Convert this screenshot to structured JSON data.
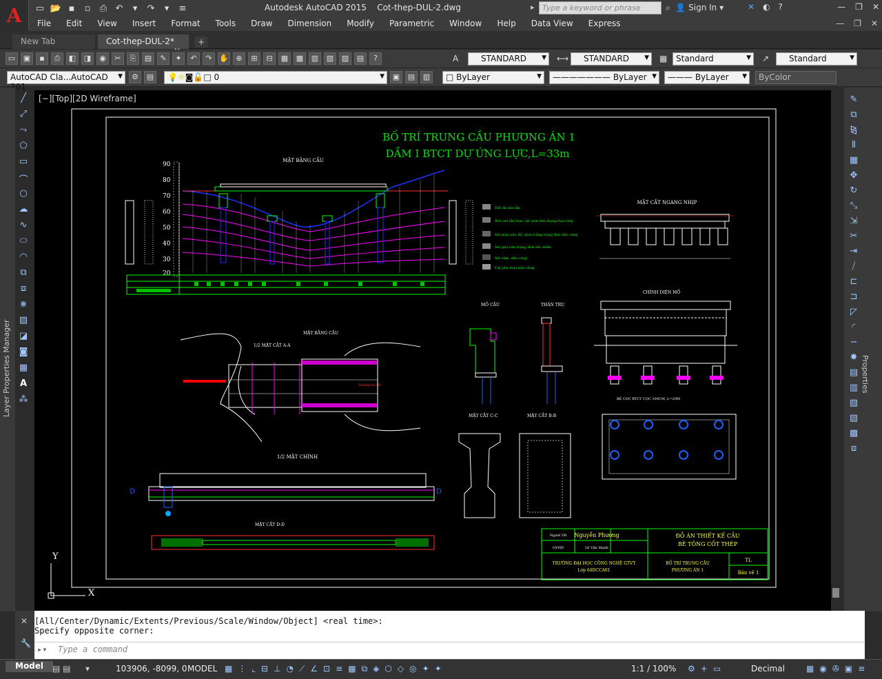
{
  "window": {
    "app_name": "Autodesk AutoCAD 2015",
    "file_name": "Cot-thep-DUL-2.dwg",
    "search_placeholder": "Type a keyword or phrase",
    "sign_in": "Sign In"
  },
  "menu": [
    "File",
    "Edit",
    "View",
    "Insert",
    "Format",
    "Tools",
    "Draw",
    "Dimension",
    "Modify",
    "Parametric",
    "Window",
    "Help",
    "Data View",
    "Express"
  ],
  "tabs": {
    "new_tab": "New Tab",
    "active_tab": "Cot-thep-DUL-2*",
    "add": "+"
  },
  "toolbar1": {
    "text_style": "STANDARD",
    "dim_style": "STANDARD",
    "table_style": "Standard",
    "mleader_style": "Standard"
  },
  "toolbar2": {
    "workspace": "AutoCAD Cla...AutoCAD 201",
    "layer": "0",
    "color": "ByLayer",
    "linetype": "ByLayer",
    "lineweight": "ByLayer",
    "plotstyle": "ByColor"
  },
  "viewport": {
    "label": "[−][Top][2D Wireframe]",
    "axis_x": "X",
    "axis_y": "Y"
  },
  "drawing": {
    "title_line1": "BỐ TRÍ TRUNG CẦU PHƯƠNG ÁN 1",
    "title_line2": "DẦM I BTCT DỰ ỨNG LỰC,L=33m",
    "profile_ticks": [
      "90",
      "80",
      "70",
      "60",
      "50",
      "40",
      "30",
      "20"
    ],
    "label_mat_bang_cau": "MẶT BẰNG CẦU",
    "label_mat_cat_ngang_nhip": "MẶT CẮT NGANG NHỊP",
    "label_chinh_dien_mo": "CHÍNH DIỆN MỐ",
    "label_mo_cau": "MỐ CẦU",
    "label_than_tru": "THÂN TRỤ",
    "label_mat_cat_cc": "MẶT CẮT C-C",
    "label_mat_cat_bb": "MẶT CẮT B-B",
    "label_half_elevation": "1/2 MẶT CHÍNH",
    "label_mat_cat_dd": "MẶT CẮT D-D",
    "label_half_section": "1/2 MẶT CẮT A-A",
    "label_huong_ha_loc": "Hướng hạ lốc",
    "dim_d": "D",
    "legend": [
      "Đất đá san lấp",
      "Bùn sét lẫn thực vật xám đen,trạng thái chảy",
      "Sét màu nâu đỏ, xám trắng,trạng thái dẻo cứng",
      "Sét pha nhẹ,trạng thái dẻo mềm",
      "Sét xám, dẻo cứng",
      "Cát pha màu nâu vàng"
    ],
    "pile_note": "BỆ CỌC BTCT    CỌC 100CM, L=20M",
    "titleblock": {
      "role1": "Người VB",
      "name1": "Nguyễn Phương",
      "role2": "GVHD",
      "name2": "Lê Văn Mạnh",
      "project1": "ĐỒ ÁN THIẾT KẾ CẦU",
      "project2": "BÊ TÔNG CỐT THÉP",
      "school1": "TRƯỜNG ĐẠI HỌC CÔNG NGHỆ GTVT",
      "school2": "Lớp 64DCCA01",
      "sheet1": "BỐ TRÍ TRUNG CẦU",
      "sheet2": "PHƯƠNG ÁN 1",
      "scale": "TL",
      "sheet_no": "Bản vẽ 1"
    }
  },
  "command": {
    "line1": "[All/Center/Dynamic/Extents/Previous/Scale/Window/Object] <real time>:",
    "line2": "Specify opposite corner:",
    "placeholder": "Type a command"
  },
  "status": {
    "model_tab": "Model",
    "coords": "103906, -8099, 0",
    "space": "MODEL",
    "scale": "1:1 / 100%",
    "units": "Decimal"
  },
  "side_labels": {
    "left": "Layer Properties Manager",
    "right": "Properties"
  },
  "colors": {
    "accent_red": "#e02020",
    "title_green": "#00e000",
    "background": "#000000"
  }
}
